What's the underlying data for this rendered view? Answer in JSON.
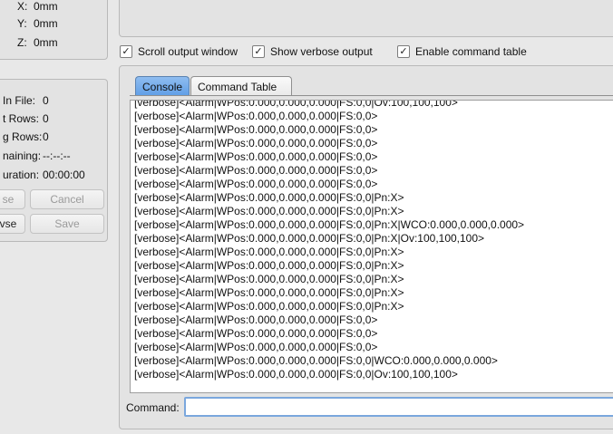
{
  "position": {
    "x_label": "X:",
    "x_value": "0mm",
    "y_label": "Y:",
    "y_value": "0mm",
    "z_label": "Z:",
    "z_value": "0mm"
  },
  "file_stats": {
    "rows_in_file_label": "In File:",
    "rows_in_file_value": "0",
    "sent_rows_label": "t Rows:",
    "sent_rows_value": "0",
    "remaining_rows_label": "g Rows:",
    "remaining_rows_value": "0",
    "time_remaining_label": "naining:",
    "time_remaining_value": "--:--:--",
    "duration_label": "uration:",
    "duration_value": "00:00:00"
  },
  "file_buttons": {
    "pause_label": "se",
    "cancel_label": "Cancel",
    "browse_label": "vse",
    "save_label": "Save"
  },
  "options": {
    "scroll_output": {
      "label": "Scroll output window",
      "checked": true
    },
    "show_verbose": {
      "label": "Show verbose output",
      "checked": true
    },
    "enable_command_table": {
      "label": "Enable command table",
      "checked": true
    }
  },
  "tabs": [
    {
      "label": "Console",
      "active": true
    },
    {
      "label": "Command Table",
      "active": false
    }
  ],
  "console_lines": [
    "[verbose]<Alarm|WPos:0.000,0.000,0.000|FS:0,0|Ov:100,100,100>",
    "[verbose]<Alarm|WPos:0.000,0.000,0.000|FS:0,0>",
    "[verbose]<Alarm|WPos:0.000,0.000,0.000|FS:0,0>",
    "[verbose]<Alarm|WPos:0.000,0.000,0.000|FS:0,0>",
    "[verbose]<Alarm|WPos:0.000,0.000,0.000|FS:0,0>",
    "[verbose]<Alarm|WPos:0.000,0.000,0.000|FS:0,0>",
    "[verbose]<Alarm|WPos:0.000,0.000,0.000|FS:0,0>",
    "[verbose]<Alarm|WPos:0.000,0.000,0.000|FS:0,0|Pn:X>",
    "[verbose]<Alarm|WPos:0.000,0.000,0.000|FS:0,0|Pn:X>",
    "[verbose]<Alarm|WPos:0.000,0.000,0.000|FS:0,0|Pn:X|WCO:0.000,0.000,0.000>",
    "[verbose]<Alarm|WPos:0.000,0.000,0.000|FS:0,0|Pn:X|Ov:100,100,100>",
    "[verbose]<Alarm|WPos:0.000,0.000,0.000|FS:0,0|Pn:X>",
    "[verbose]<Alarm|WPos:0.000,0.000,0.000|FS:0,0|Pn:X>",
    "[verbose]<Alarm|WPos:0.000,0.000,0.000|FS:0,0|Pn:X>",
    "[verbose]<Alarm|WPos:0.000,0.000,0.000|FS:0,0|Pn:X>",
    "[verbose]<Alarm|WPos:0.000,0.000,0.000|FS:0,0|Pn:X>",
    "[verbose]<Alarm|WPos:0.000,0.000,0.000|FS:0,0>",
    "[verbose]<Alarm|WPos:0.000,0.000,0.000|FS:0,0>",
    "[verbose]<Alarm|WPos:0.000,0.000,0.000|FS:0,0>",
    "[verbose]<Alarm|WPos:0.000,0.000,0.000|FS:0,0|WCO:0.000,0.000,0.000>",
    "[verbose]<Alarm|WPos:0.000,0.000,0.000|FS:0,0|Ov:100,100,100>"
  ],
  "command": {
    "label": "Command:",
    "value": ""
  },
  "colors": {
    "accent": "#3f86d6",
    "tab_active": "#5f9ee6"
  }
}
